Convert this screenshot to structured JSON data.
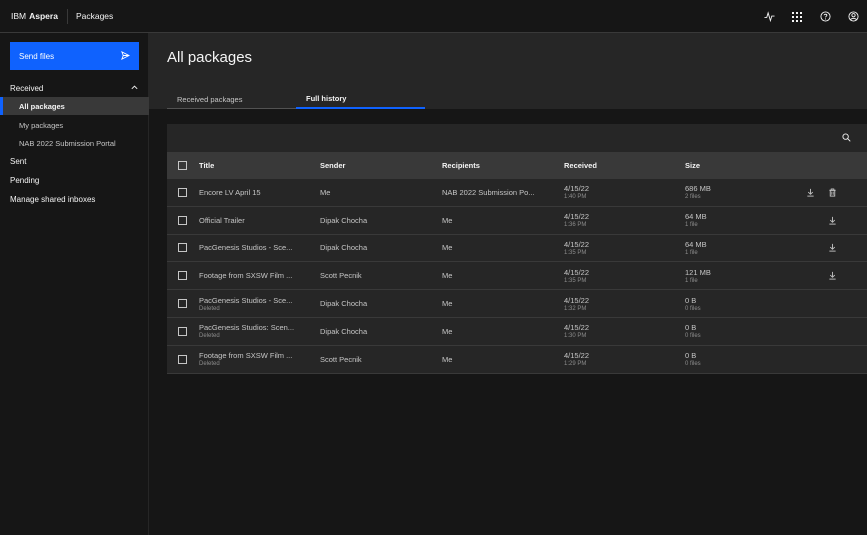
{
  "header": {
    "brand_1": "IBM",
    "brand_2": "Aspera",
    "app_name": "Packages",
    "icons": [
      "activity-icon",
      "app-switcher-icon",
      "help-icon",
      "user-profile-icon"
    ]
  },
  "sidebar": {
    "send_label": "Send files",
    "received_label": "Received",
    "received_items": [
      {
        "label": "All packages",
        "active": true
      },
      {
        "label": "My packages",
        "active": false
      },
      {
        "label": "NAB 2022 Submission Portal",
        "active": false
      }
    ],
    "sent_label": "Sent",
    "pending_label": "Pending",
    "manage_label": "Manage shared inboxes"
  },
  "main": {
    "title": "All packages",
    "tabs": [
      {
        "label": "Received packages",
        "selected": false
      },
      {
        "label": "Full history",
        "selected": true
      }
    ]
  },
  "table": {
    "columns": {
      "title": "Title",
      "sender": "Sender",
      "recipients": "Recipients",
      "received": "Received",
      "size": "Size"
    },
    "rows": [
      {
        "title": "Encore LV April 15",
        "title_sub": "",
        "sender": "Me",
        "recipients": "NAB 2022 Submission Po...",
        "date": "4/15/22",
        "time": "1:40 PM",
        "size": "686 MB",
        "files": "2 files",
        "download": true,
        "delete": true
      },
      {
        "title": "Official Trailer",
        "title_sub": "",
        "sender": "Dipak Chocha",
        "recipients": "Me",
        "date": "4/15/22",
        "time": "1:36 PM",
        "size": "64 MB",
        "files": "1 file",
        "download": true,
        "delete": false
      },
      {
        "title": "PacGenesis Studios - Sce...",
        "title_sub": "",
        "sender": "Dipak Chocha",
        "recipients": "Me",
        "date": "4/15/22",
        "time": "1:35 PM",
        "size": "64 MB",
        "files": "1 file",
        "download": true,
        "delete": false
      },
      {
        "title": "Footage from SXSW Film ...",
        "title_sub": "",
        "sender": "Scott Pecnik",
        "recipients": "Me",
        "date": "4/15/22",
        "time": "1:35 PM",
        "size": "121 MB",
        "files": "1 file",
        "download": true,
        "delete": false
      },
      {
        "title": "PacGenesis Studios - Sce...",
        "title_sub": "Deleted",
        "sender": "Dipak Chocha",
        "recipients": "Me",
        "date": "4/15/22",
        "time": "1:32 PM",
        "size": "0 B",
        "files": "0 files",
        "download": false,
        "delete": false
      },
      {
        "title": "PacGenesis Studios: Scen...",
        "title_sub": "Deleted",
        "sender": "Dipak Chocha",
        "recipients": "Me",
        "date": "4/15/22",
        "time": "1:30 PM",
        "size": "0 B",
        "files": "0 files",
        "download": false,
        "delete": false
      },
      {
        "title": "Footage from SXSW Film ...",
        "title_sub": "Deleted",
        "sender": "Scott Pecnik",
        "recipients": "Me",
        "date": "4/15/22",
        "time": "1:29 PM",
        "size": "0 B",
        "files": "0 files",
        "download": false,
        "delete": false
      }
    ]
  },
  "colors": {
    "accent": "#0f62fe",
    "background": "#161616",
    "surface": "#262626",
    "header_row": "#393939"
  }
}
